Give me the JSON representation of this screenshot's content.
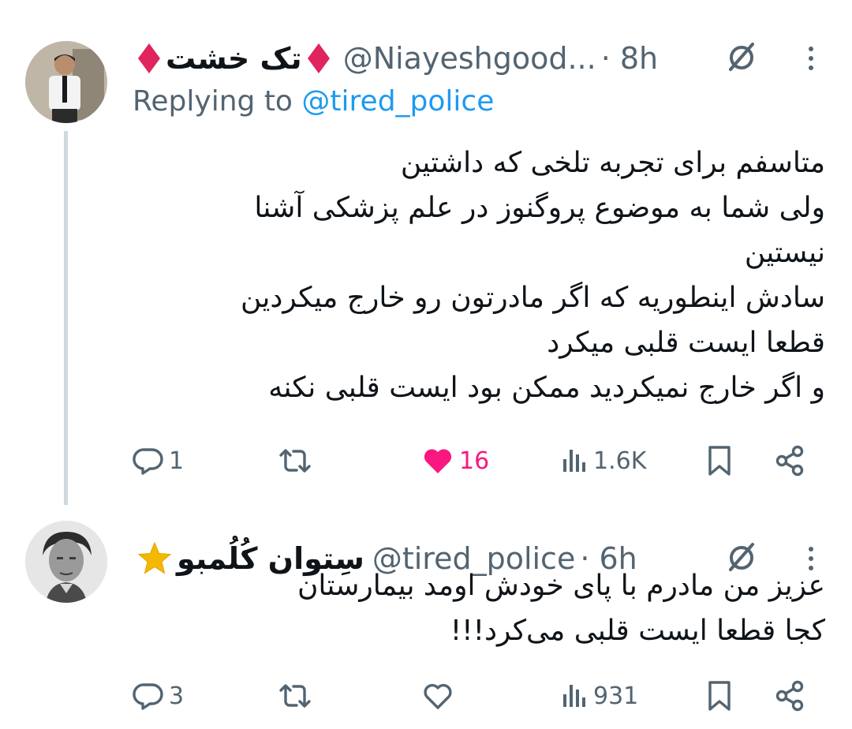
{
  "tweets": [
    {
      "display_name": "تک خشت",
      "badge_icon": "red-diamond-icon",
      "handle": "@Niayeshgood...",
      "time": "· 8h",
      "replying_prefix": "Replying to",
      "replying_to": "@tired_police",
      "body_lines": [
        "متاسفم برای تجربه تلخی که داشتین",
        "ولی شما به موضوع پروگنوز در علم پزشکی آشنا",
        "نیستین",
        "سادش اینطوریه که اگر مادرتون رو خارج میکردین",
        "قطعا ایست قلبی میکرد",
        "و اگر خارج نمیکردید ممکن بود ایست قلبی نکنه"
      ],
      "replies": "1",
      "retweets": "",
      "likes": "16",
      "liked": true,
      "views": "1.6K"
    },
    {
      "display_name": "سِتوان کُلُمبو",
      "badge_icon": "star-icon",
      "handle": "@tired_police",
      "time": "· 6h",
      "body_lines": [
        "عزیز من مادرم با پای خودش اومد بیمارستان",
        "کجا قطعا ایست قلبی می‌کرد!!!"
      ],
      "replies": "3",
      "retweets": "",
      "likes": "",
      "liked": false,
      "views": "931"
    }
  ],
  "colors": {
    "text": "#0f1419",
    "secondary": "#536471",
    "mention": "#1d9bf0",
    "like": "#f91880",
    "diamond": "#e0245e",
    "star": "#f5b800"
  }
}
